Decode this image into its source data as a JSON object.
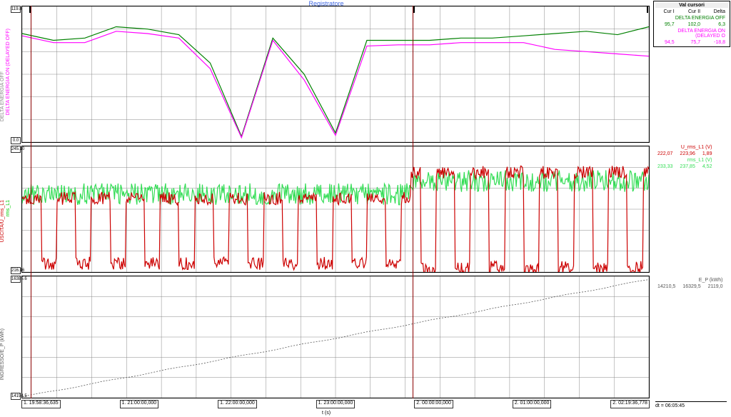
{
  "title": "Registratore",
  "xaxis_label": "t (s)",
  "x_ticks": [
    "1. 19:58:36,635",
    "1. 21:00:00,000",
    "1. 22:00:00,000",
    "1. 23:00:00,000",
    "2. 00:00:00,000",
    "2. 01:00:00,000",
    "2. 02:19:36,778"
  ],
  "panel1": {
    "series_a": {
      "name": "DELTA ENERGIA OFF",
      "color": "#008000"
    },
    "series_b": {
      "name": "DELTA ENERGIA ON (DELAYED OFF)",
      "color": "#ff00ff"
    },
    "yrange_a": "0.0 ... 119.9",
    "yrange_b": "0.0 ... 119.8"
  },
  "panel2": {
    "series_a": {
      "name": "USCITA/U_rms_L1",
      "color": "#cc0000"
    },
    "series_b": {
      "name": "rms_L1",
      "color": "#33dd55"
    },
    "yrange_a": "216.16 ... 245.10",
    "yrange_b": "V"
  },
  "panel3": {
    "series": {
      "name": "INGRESSO/E_P (kWh)",
      "color": "#555555"
    },
    "yrange": "14194.5 ... 16385.6"
  },
  "cursor_panel": {
    "header": "Val cursori",
    "cols": [
      "Cur I",
      "Cur II",
      "Delta"
    ],
    "rows": [
      {
        "name": "DELTA ENERGIA OFF",
        "color": "#008000",
        "vals": [
          "95,7",
          "102,0",
          "6,3"
        ]
      },
      {
        "name": "DELTA ENERGIA ON (DELAYED O",
        "color": "#ff00ff",
        "vals": [
          "94,5",
          "75,7",
          "-18,8"
        ]
      }
    ],
    "rows_p2": [
      {
        "name": "U_rms_L1 (V)",
        "color": "#cc0000",
        "vals": [
          "222,07",
          "223,96",
          "1,89"
        ]
      },
      {
        "name": "rms_L1 (V)",
        "color": "#33dd55",
        "vals": [
          "233,33",
          "237,85",
          "4,52"
        ]
      }
    ],
    "rows_p3": [
      {
        "name": "E_P (kWh)",
        "color": "#555555",
        "vals": [
          "14210,5",
          "16329,5",
          "2119,0"
        ]
      }
    ],
    "dt": "dt = 06:05:45"
  },
  "chart_data": {
    "type": "line",
    "x_range_label": [
      "Day1 19:58:36",
      "Day2 02:19:36"
    ],
    "panels": [
      {
        "id": "energy-delta",
        "ylabel_left": "DELTA ENERGIA OFF",
        "ylabel_right": "DELTA ENERGIA ON (DELAYED OFF)",
        "ylim": [
          0,
          120
        ],
        "series": [
          {
            "name": "DELTA ENERGIA OFF",
            "color": "#008000",
            "x": [
              0,
              0.05,
              0.1,
              0.15,
              0.2,
              0.25,
              0.3,
              0.35,
              0.4,
              0.45,
              0.5,
              0.55,
              0.6,
              0.65,
              0.7,
              0.75,
              0.8,
              0.85,
              0.9,
              0.95,
              1.0
            ],
            "y": [
              96,
              90,
              92,
              102,
              100,
              95,
              70,
              5,
              92,
              60,
              8,
              90,
              90,
              90,
              92,
              92,
              94,
              96,
              98,
              95,
              102
            ]
          },
          {
            "name": "DELTA ENERGIA ON (DELAYED OFF)",
            "color": "#ff00ff",
            "x": [
              0,
              0.05,
              0.1,
              0.15,
              0.2,
              0.25,
              0.3,
              0.35,
              0.4,
              0.45,
              0.5,
              0.55,
              0.6,
              0.65,
              0.7,
              0.75,
              0.8,
              0.85,
              0.9,
              0.95,
              1.0
            ],
            "y": [
              94,
              88,
              88,
              98,
              96,
              92,
              65,
              4,
              90,
              55,
              6,
              85,
              86,
              86,
              88,
              88,
              88,
              82,
              80,
              78,
              76
            ]
          }
        ]
      },
      {
        "id": "voltage",
        "ylabel_left": "USCITA/U_rms_L1",
        "ylabel_right": "rms_L1",
        "ylim": [
          216,
          245
        ],
        "series": [
          {
            "name": "U_rms_L1",
            "color": "#cc0000",
            "unit": "V",
            "pattern": "square-wave-noisy",
            "low": 218,
            "high": 233,
            "period_frac": 0.055
          },
          {
            "name": "rms_L1",
            "color": "#33dd55",
            "unit": "V",
            "pattern": "noisy-flat",
            "mean": 234,
            "band": 5
          }
        ]
      },
      {
        "id": "energy-total",
        "ylabel": "INGRESSO/E_P",
        "unit": "kWh",
        "ylim": [
          14195,
          16386
        ],
        "series": [
          {
            "name": "E_P",
            "color": "#555555",
            "x": [
              0,
              1.0
            ],
            "y": [
              14210.5,
              16329.5
            ],
            "shape": "monotone-increasing"
          }
        ]
      }
    ],
    "cursors": {
      "I_frac": 0.015,
      "II_frac": 0.623
    }
  }
}
